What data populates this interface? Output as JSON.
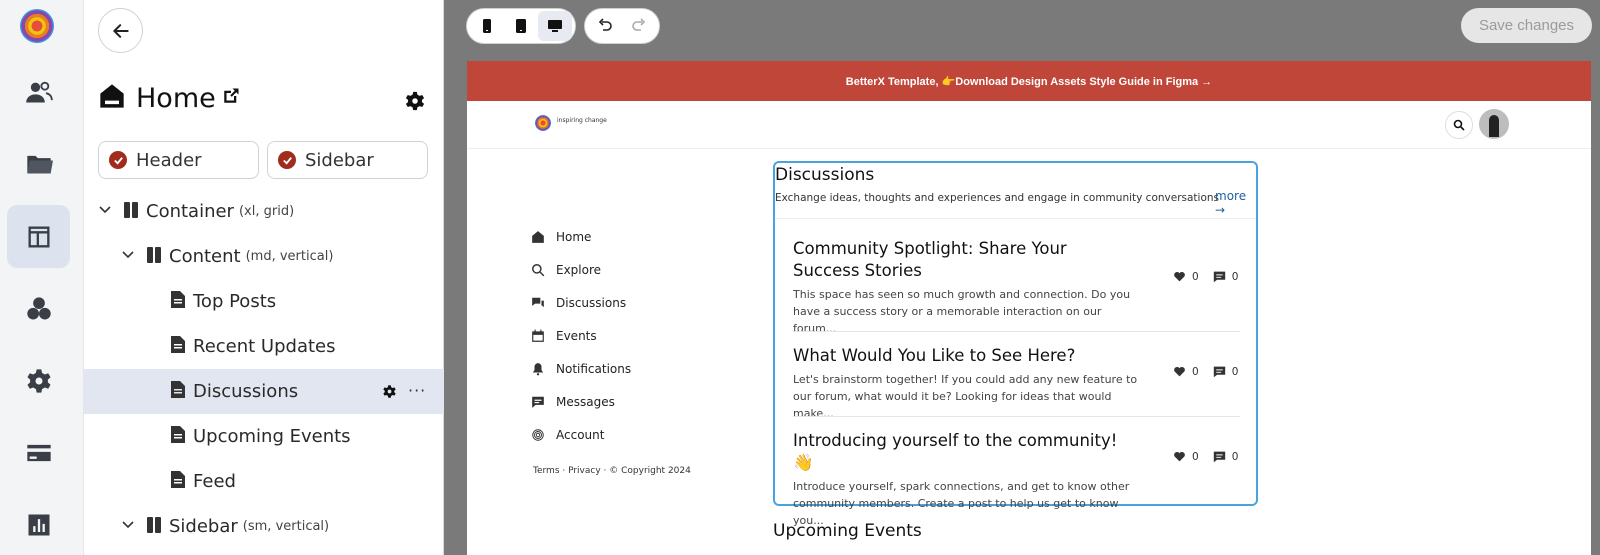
{
  "rail": {
    "items": [
      {
        "icon": "users-icon"
      },
      {
        "icon": "folder-icon"
      },
      {
        "icon": "layout-icon",
        "active": true
      },
      {
        "icon": "shapes-icon"
      },
      {
        "icon": "gear-icon"
      },
      {
        "icon": "credit-card-icon"
      },
      {
        "icon": "chart-icon"
      }
    ]
  },
  "panel": {
    "title": "Home",
    "toggles": {
      "header": "Header",
      "sidebar": "Sidebar"
    },
    "tree": {
      "container": {
        "label": "Container",
        "sub": "(xl, grid)"
      },
      "content": {
        "label": "Content",
        "sub": "(md, vertical)"
      },
      "items": [
        "Top Posts",
        "Recent Updates",
        "Discussions",
        "Upcoming Events",
        "Feed"
      ],
      "sidebar": {
        "label": "Sidebar",
        "sub": "(sm, vertical)"
      }
    },
    "more_glyph": "···"
  },
  "toolbar": {
    "save_label": "Save changes"
  },
  "preview": {
    "banner": "BetterX Template, 👉Download Design Assets Style Guide in Figma →",
    "tagline": "inspiring change",
    "nav": [
      "Home",
      "Explore",
      "Discussions",
      "Events",
      "Notifications",
      "Messages",
      "Account"
    ],
    "footer": "Terms · Privacy · © Copyright 2024",
    "discussions": {
      "title": "Discussions",
      "description": "Exchange ideas, thoughts and experiences and engage in community conversations",
      "more": "more →",
      "posts": [
        {
          "title": "Community Spotlight: Share Your Success Stories",
          "body": "This space has seen so much growth and connection. Do you have a success story or a memorable interaction on our forum...",
          "likes": "0",
          "comments": "0"
        },
        {
          "title": "What Would You Like to See Here?",
          "body": "Let's brainstorm together! If you could add any new feature to our forum, what would it be? Looking for ideas that would make...",
          "likes": "0",
          "comments": "0"
        },
        {
          "title": "Introducing yourself to the community! 👋",
          "body": "Introduce yourself, spark connections, and get to know other community members. Create a post to help us get to know you...",
          "likes": "0",
          "comments": "0"
        }
      ]
    },
    "events_title": "Upcoming Events"
  },
  "colors": {
    "banner": "#c0463a",
    "checkbox": "#a02c1e",
    "selection_border": "#4aa3df",
    "selected_row": "#e1e6f0",
    "canvas": "#7a7a7a"
  }
}
